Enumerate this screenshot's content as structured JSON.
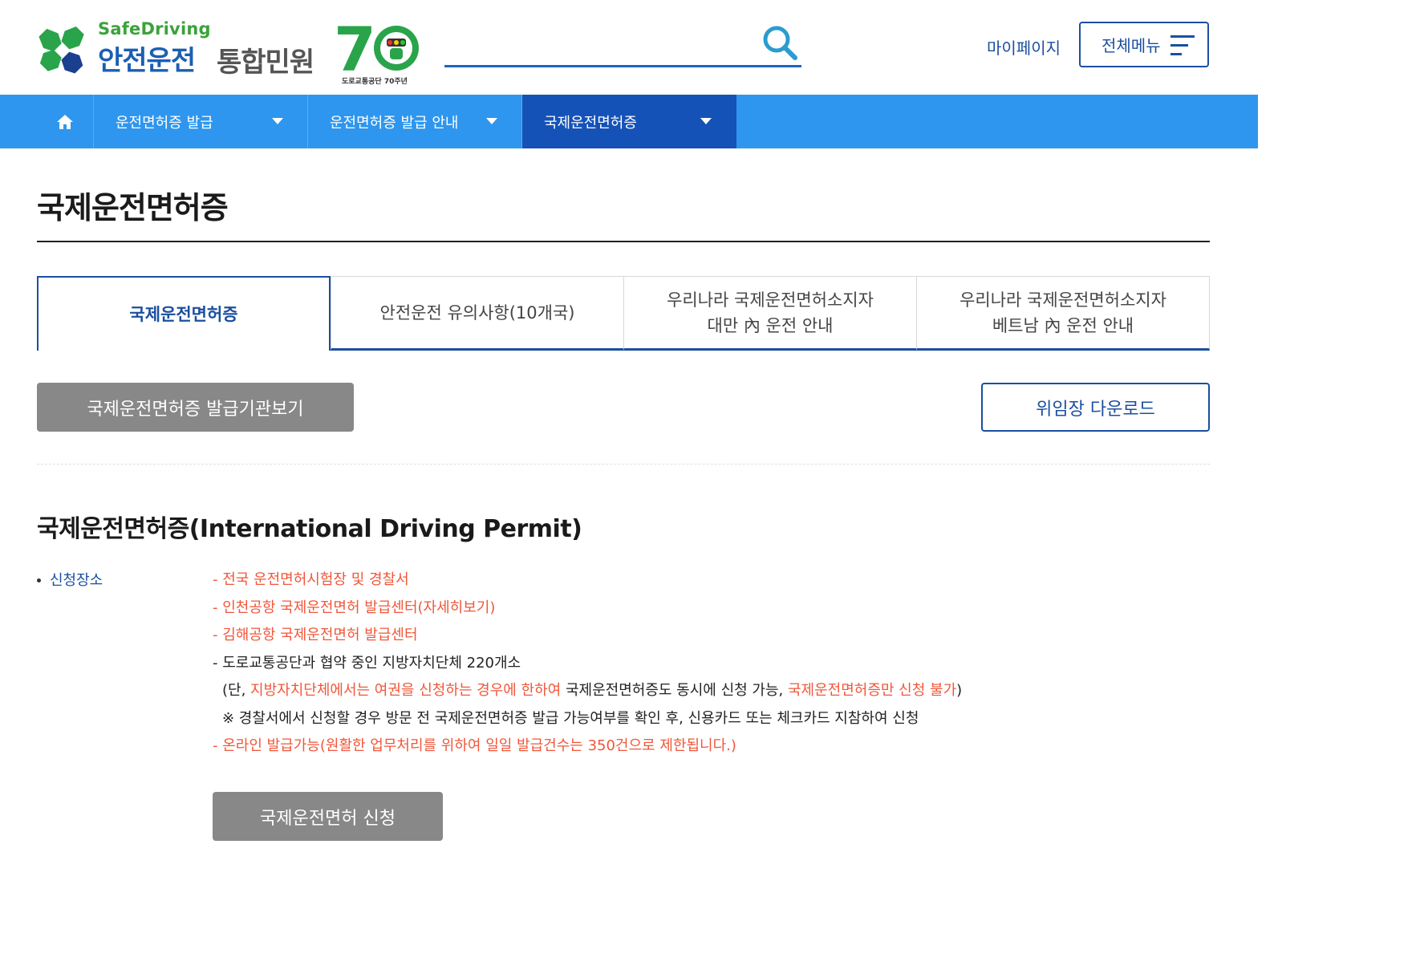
{
  "header": {
    "brand_en": "SafeDriving",
    "brand_ko": "안전운전",
    "brand_sub": "통합민원",
    "anniversary_caption": "도로교통공단 70주년",
    "search_placeholder": "",
    "mypage_label": "마이페이지",
    "allmenu_label": "전체메뉴",
    "accent_color": "#1b4fa0"
  },
  "nav": {
    "home_icon": "home-icon",
    "items": [
      {
        "label": "운전면허증 발급"
      },
      {
        "label": "운전면허증 발급 안내"
      },
      {
        "label": "국제운전면허증"
      }
    ],
    "bg_color": "#2e96ee",
    "active_color": "#1552b8"
  },
  "page": {
    "title": "국제운전면허증"
  },
  "tabs": [
    {
      "line1": "국제운전면허증",
      "line2": ""
    },
    {
      "line1": "안전운전 유의사항(10개국)",
      "line2": ""
    },
    {
      "line1": "우리나라 국제운전면허소지자",
      "line2": "대만 內 운전 안내"
    },
    {
      "line1": "우리나라 국제운전면허소지자",
      "line2": "베트남 內 운전 안내"
    }
  ],
  "buttons": {
    "agency": "국제운전면허증 발급기관보기",
    "download": "위임장 다운로드",
    "apply": "국제운전면허 신청"
  },
  "section": {
    "title": "국제운전면허증(International Driving Permit)",
    "bullet_label": "신청장소",
    "lines": {
      "l1": "- 전국 운전면허시험장 및 경찰서",
      "l2": "- 인천공항 국제운전면허 발급센터(자세히보기)",
      "l3": "- 김해공항 국제운전면허 발급센터",
      "l4": "- 도로교통공단과 협약 중인 지방자치단체 220개소",
      "l5a": "(단, ",
      "l5b": "지방자치단체에서는 여권을 신청하는 경우에 한하여",
      "l5c": " 국제운전면허증도 동시에 신청 가능, ",
      "l5d": "국제운전면허증만 신청 불가",
      "l5e": ")",
      "l6": "※ 경찰서에서 신청할 경우 방문 전 국제운전면허증 발급 가능여부를 확인 후, 신용카드 또는 체크카드 지참하여 신청",
      "l7": "- 온라인 발급가능(원활한 업무처리를 위하여 일일 발급건수는 350건으로 제한됩니다.)"
    },
    "highlight_color": "#f0573a"
  }
}
